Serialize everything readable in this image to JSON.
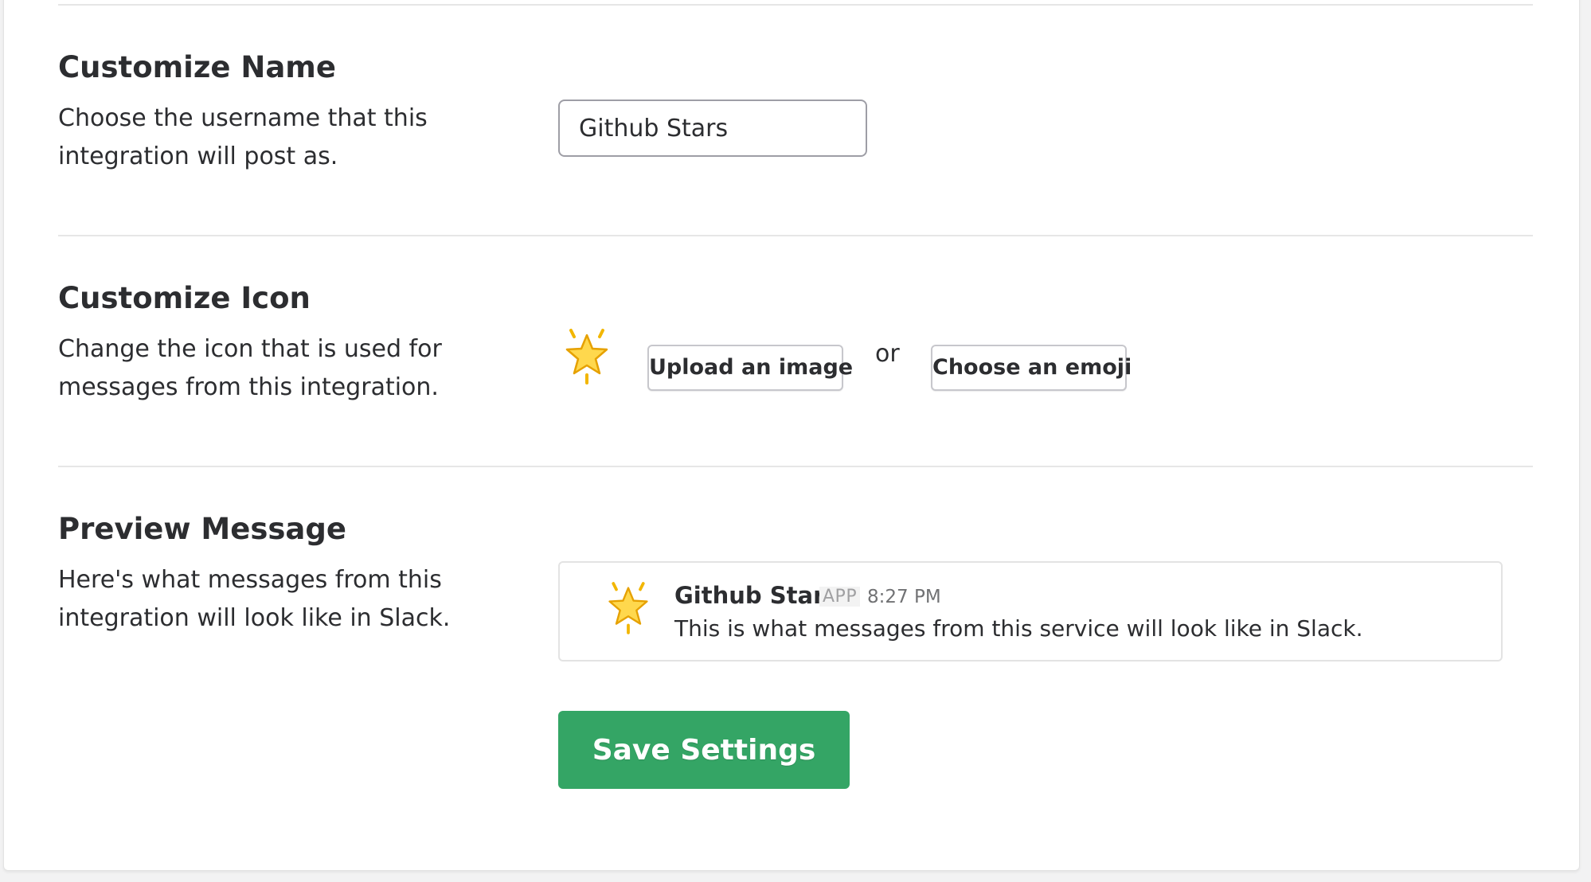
{
  "name_section": {
    "title": "Customize Name",
    "description": "Choose the username that this integration will post as.",
    "username_value": "Github Stars"
  },
  "icon_section": {
    "title": "Customize Icon",
    "description": "Change the icon that is used for messages from this integration.",
    "current_icon": "glowing-star-icon",
    "upload_label": "Upload an image",
    "or_label": "or",
    "emoji_label": "Choose an emoji"
  },
  "preview_section": {
    "title": "Preview Message",
    "description": "Here's what messages from this integration will look like in Slack.",
    "sender_name": "Github Stars",
    "badge": "APP",
    "time": "8:27 PM",
    "message": "This is what messages from this service will look like in Slack."
  },
  "save_label": "Save Settings",
  "colors": {
    "save_button": "#34a565",
    "star_fill": "#ffd84d",
    "star_outline": "#e6a100"
  }
}
